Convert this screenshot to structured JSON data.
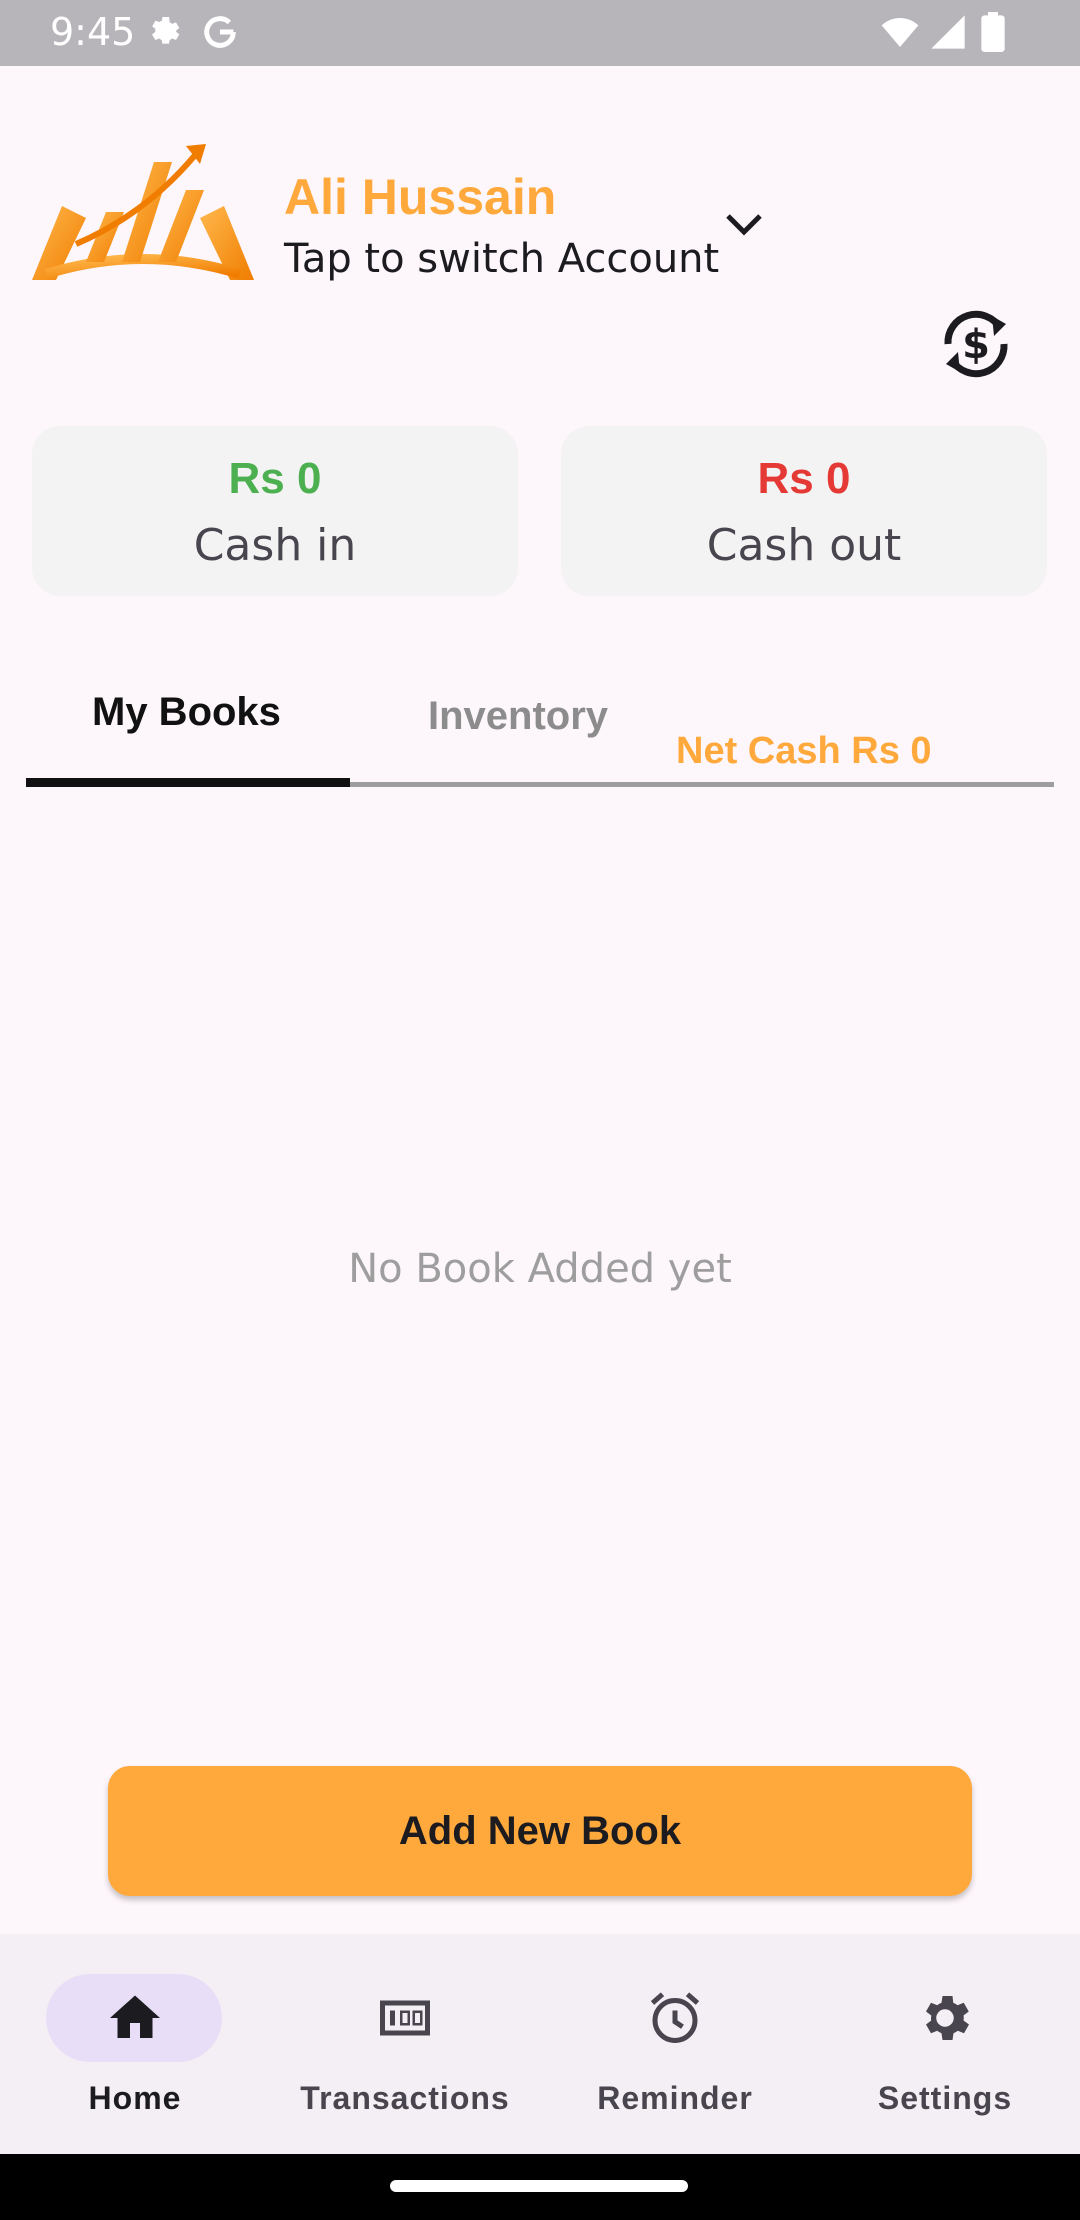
{
  "status_bar": {
    "time": "9:45"
  },
  "account": {
    "name": "Ali Hussain",
    "subtitle": "Tap to switch Account"
  },
  "summary": {
    "cash_in": {
      "amount": "Rs 0",
      "label": "Cash in",
      "color": "#4caf50"
    },
    "cash_out": {
      "amount": "Rs 0",
      "label": "Cash out",
      "color": "#e53935"
    }
  },
  "tabs": [
    {
      "label": "My Books",
      "active": true
    },
    {
      "label": "Inventory",
      "active": false
    }
  ],
  "net_cash": "Net Cash Rs 0",
  "empty_state": "No Book Added yet",
  "add_book_label": "Add New Book",
  "bottom_nav": [
    {
      "label": "Home",
      "icon": "home-icon",
      "active": true
    },
    {
      "label": "Transactions",
      "icon": "banknote-icon",
      "active": false
    },
    {
      "label": "Reminder",
      "icon": "alarm-icon",
      "active": false
    },
    {
      "label": "Settings",
      "icon": "gear-icon",
      "active": false
    }
  ],
  "colors": {
    "accent": "#ffa93d",
    "background": "#fdf6fb",
    "nav_active": "#e8def8"
  }
}
